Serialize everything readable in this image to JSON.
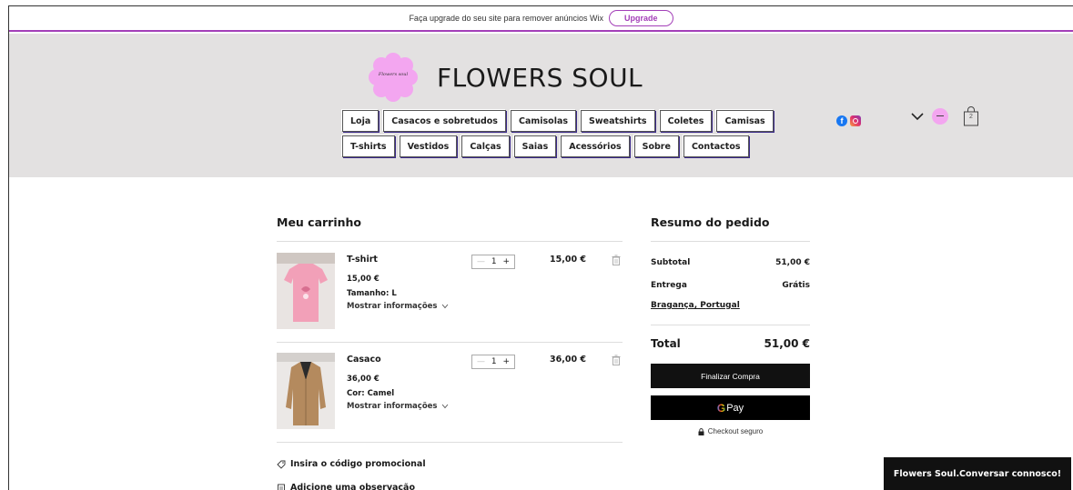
{
  "wix_bar": {
    "message": "Faça upgrade do seu site para remover anúncios Wix",
    "upgrade_label": "Upgrade"
  },
  "brand": {
    "logo_text": "Flowers soul",
    "name": "FLOWERS SOUL"
  },
  "nav": {
    "row1": [
      "Loja",
      "Casacos e sobretudos",
      "Camisolas",
      "Sweatshirts",
      "Coletes",
      "Camisas"
    ],
    "row2": [
      "T-shirts",
      "Vestidos",
      "Calças",
      "Saias",
      "Acessórios",
      "Sobre",
      "Contactos"
    ]
  },
  "header_icons": {
    "bag_count": "2"
  },
  "cart": {
    "title": "Meu carrinho",
    "items": [
      {
        "name": "T-shirt",
        "unit_price": "15,00 €",
        "attribute": "Tamanho: L",
        "more_label": "Mostrar informações",
        "quantity": "1",
        "total": "15,00 €"
      },
      {
        "name": "Casaco",
        "unit_price": "36,00 €",
        "attribute": "Cor: Camel",
        "more_label": "Mostrar informações",
        "quantity": "1",
        "total": "36,00 €"
      }
    ],
    "promo_label": "Insira o código promocional",
    "note_label": "Adicione uma observação"
  },
  "summary": {
    "title": "Resumo do pedido",
    "subtotal_label": "Subtotal",
    "subtotal_value": "51,00 €",
    "shipping_label": "Entrega",
    "shipping_value": "Grátis",
    "shipping_location": "Bragança, Portugal",
    "total_label": "Total",
    "total_value": "51,00 €",
    "checkout_label": "Finalizar Compra",
    "gpay_g": "G",
    "gpay_label": "Pay",
    "secure_label": "Checkout seguro"
  },
  "chat": {
    "label": "Flowers Soul.Conversar connosco!"
  },
  "colors": {
    "accent": "#a33fb8",
    "header_bg": "#e3e1e1",
    "logo_pink": "#f3a6f0",
    "button_dark": "#111111"
  }
}
